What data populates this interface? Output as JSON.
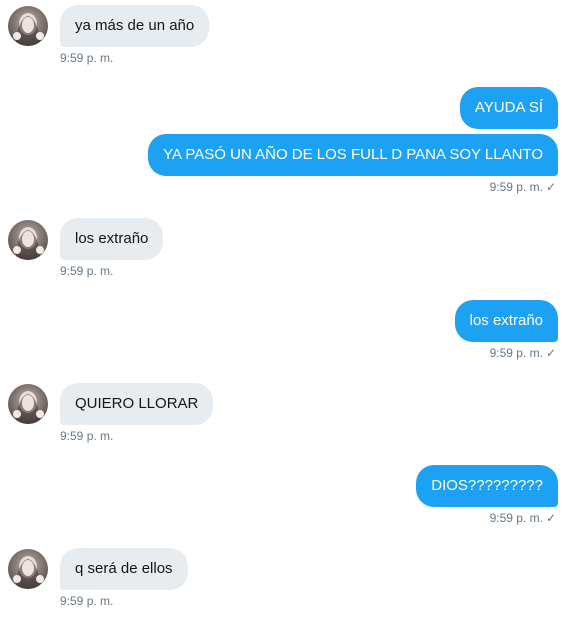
{
  "conversation": {
    "messages": [
      {
        "direction": "in",
        "text": "ya más de un año",
        "time": "9:59 p. m."
      },
      {
        "direction": "out",
        "text": "AYUDA SÍ"
      },
      {
        "direction": "out",
        "text": "YA PASÓ UN AÑO DE LOS FULL D PANA SOY LLANTO",
        "time": "9:59 p. m."
      },
      {
        "direction": "in",
        "text": "los extraño",
        "time": "9:59 p. m."
      },
      {
        "direction": "out",
        "text": "los extraño",
        "time": "9:59 p. m."
      },
      {
        "direction": "in",
        "text": "QUIERO LLORAR",
        "time": "9:59 p. m."
      },
      {
        "direction": "out",
        "text": "DIOS?????????",
        "time": "9:59 p. m."
      },
      {
        "direction": "in",
        "text": "q será de ellos",
        "time": "9:59 p. m."
      }
    ],
    "read_icon": "checkmark-icon",
    "check_glyph": "✓"
  },
  "colors": {
    "incoming_bubble": "#e6ecf0",
    "outgoing_bubble": "#1da1f2",
    "timestamp": "#657786"
  }
}
